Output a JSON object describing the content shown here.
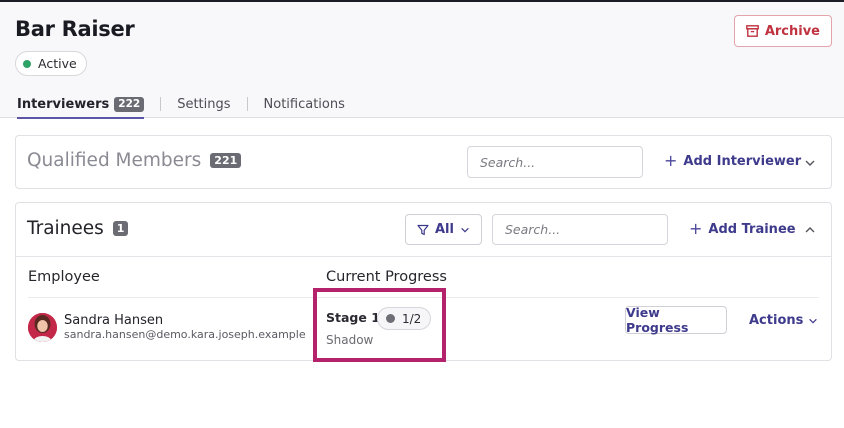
{
  "page": {
    "title": "Bar Raiser",
    "status": "Active",
    "archive_label": "Archive",
    "colors": {
      "accent": "#3e3a8c",
      "status_active": "#2ea367",
      "danger": "#c0323f",
      "highlight": "#b5226c"
    }
  },
  "tabs": [
    {
      "label": "Interviewers",
      "count": "222",
      "active": true
    },
    {
      "label": "Settings"
    },
    {
      "label": "Notifications"
    }
  ],
  "qualified": {
    "title": "Qualified Members",
    "count": "221",
    "search_placeholder": "Search...",
    "add_label": "Add Interviewer"
  },
  "trainees": {
    "title": "Trainees",
    "count": "1",
    "filter_label": "All",
    "search_placeholder": "Search...",
    "add_label": "Add Trainee",
    "columns": [
      "Employee",
      "Current Progress"
    ],
    "rows": [
      {
        "name": "Sandra Hansen",
        "email": "sandra.hansen@demo.kara.joseph.example",
        "stage": "Stage 1",
        "progress": "1/2",
        "substage": "Shadow",
        "view_label": "View Progress",
        "actions_label": "Actions"
      }
    ]
  },
  "icons": [
    "archive-icon",
    "plus-icon",
    "chevron-down-icon",
    "chevron-up-icon",
    "filter-icon",
    "status-dot-icon"
  ]
}
